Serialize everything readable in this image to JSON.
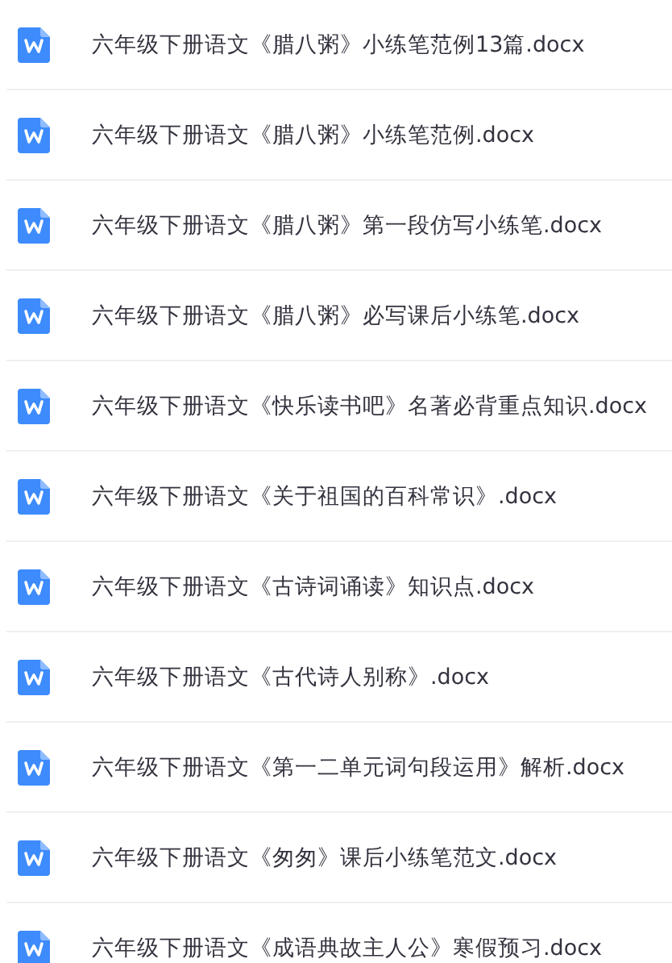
{
  "files": [
    {
      "name": "六年级下册语文《腊八粥》小练笔范例13篇.docx"
    },
    {
      "name": "六年级下册语文《腊八粥》小练笔范例.docx"
    },
    {
      "name": "六年级下册语文《腊八粥》第一段仿写小练笔.docx"
    },
    {
      "name": "六年级下册语文《腊八粥》必写课后小练笔.docx"
    },
    {
      "name": "六年级下册语文《快乐读书吧》名著必背重点知识.docx"
    },
    {
      "name": "六年级下册语文《关于祖国的百科常识》.docx"
    },
    {
      "name": "六年级下册语文《古诗词诵读》知识点.docx"
    },
    {
      "name": "六年级下册语文《古代诗人别称》.docx"
    },
    {
      "name": "六年级下册语文《第一二单元词句段运用》解析.docx"
    },
    {
      "name": "六年级下册语文《匆匆》课后小练笔范文.docx"
    },
    {
      "name": "六年级下册语文《成语典故主人公》寒假预习.docx"
    }
  ]
}
